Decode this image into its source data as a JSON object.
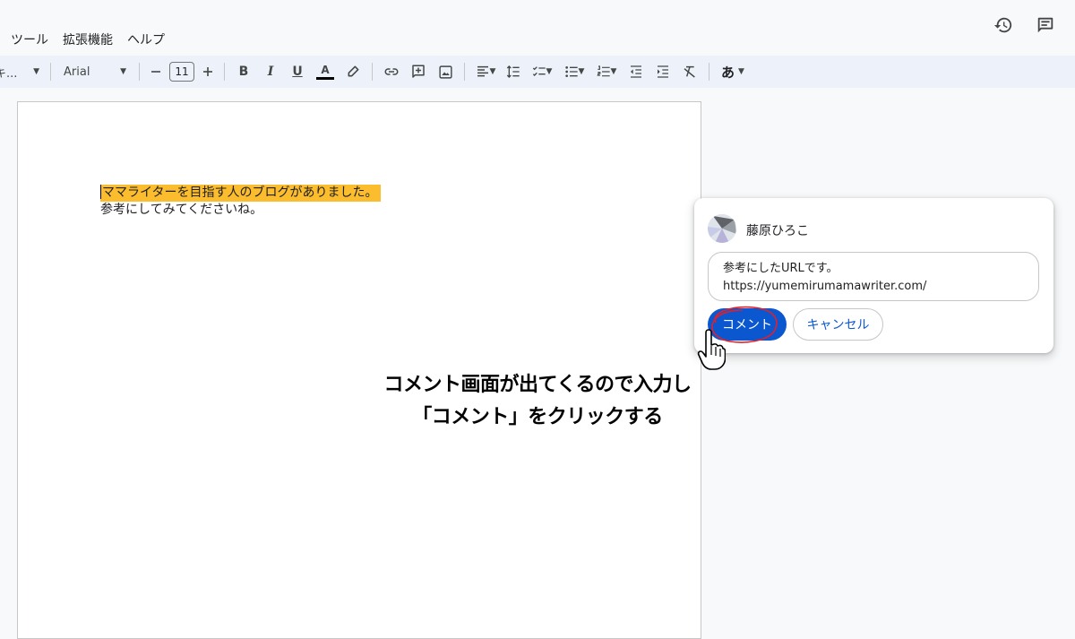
{
  "menu": {
    "items": [
      "ツール",
      "拡張機能",
      "ヘルプ"
    ]
  },
  "toolbar": {
    "style_label": "キ...",
    "font_name": "Arial",
    "font_size": "11",
    "bold": "B",
    "italic": "I",
    "underline": "U",
    "text_color": "A",
    "input_tools": "あ"
  },
  "document": {
    "line1": "ママライターを目指す人のブログがありました。",
    "line2": "参考にしてみてくださいね。",
    "highlight_color": "#fbbc2e"
  },
  "comment": {
    "user_name": "藤原ひろこ",
    "text_line1": "参考にしたURLです。",
    "text_line2": "https://yumemirumamawriter.com/",
    "submit_label": "コメント",
    "cancel_label": "キャンセル",
    "accent_color": "#0b57d0"
  },
  "annotation": {
    "line1": "コメント画面が出てくるので入力し",
    "line2": "「コメント」をクリックする"
  }
}
